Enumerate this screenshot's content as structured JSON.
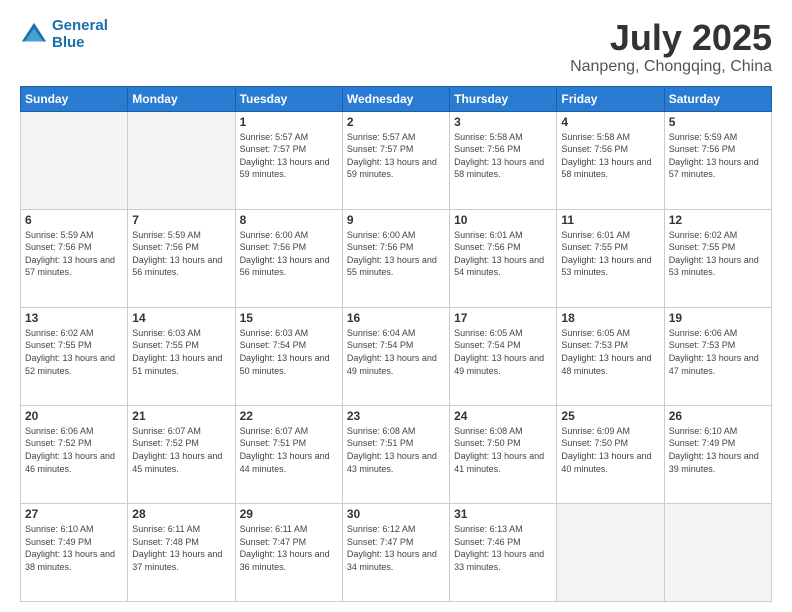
{
  "header": {
    "logo_line1": "General",
    "logo_line2": "Blue",
    "month": "July 2025",
    "location": "Nanpeng, Chongqing, China"
  },
  "weekdays": [
    "Sunday",
    "Monday",
    "Tuesday",
    "Wednesday",
    "Thursday",
    "Friday",
    "Saturday"
  ],
  "weeks": [
    [
      {
        "day": "",
        "empty": true
      },
      {
        "day": "",
        "empty": true
      },
      {
        "day": "1",
        "sunrise": "5:57 AM",
        "sunset": "7:57 PM",
        "daylight": "13 hours and 59 minutes."
      },
      {
        "day": "2",
        "sunrise": "5:57 AM",
        "sunset": "7:57 PM",
        "daylight": "13 hours and 59 minutes."
      },
      {
        "day": "3",
        "sunrise": "5:58 AM",
        "sunset": "7:56 PM",
        "daylight": "13 hours and 58 minutes."
      },
      {
        "day": "4",
        "sunrise": "5:58 AM",
        "sunset": "7:56 PM",
        "daylight": "13 hours and 58 minutes."
      },
      {
        "day": "5",
        "sunrise": "5:59 AM",
        "sunset": "7:56 PM",
        "daylight": "13 hours and 57 minutes."
      }
    ],
    [
      {
        "day": "6",
        "sunrise": "5:59 AM",
        "sunset": "7:56 PM",
        "daylight": "13 hours and 57 minutes."
      },
      {
        "day": "7",
        "sunrise": "5:59 AM",
        "sunset": "7:56 PM",
        "daylight": "13 hours and 56 minutes."
      },
      {
        "day": "8",
        "sunrise": "6:00 AM",
        "sunset": "7:56 PM",
        "daylight": "13 hours and 56 minutes."
      },
      {
        "day": "9",
        "sunrise": "6:00 AM",
        "sunset": "7:56 PM",
        "daylight": "13 hours and 55 minutes."
      },
      {
        "day": "10",
        "sunrise": "6:01 AM",
        "sunset": "7:56 PM",
        "daylight": "13 hours and 54 minutes."
      },
      {
        "day": "11",
        "sunrise": "6:01 AM",
        "sunset": "7:55 PM",
        "daylight": "13 hours and 53 minutes."
      },
      {
        "day": "12",
        "sunrise": "6:02 AM",
        "sunset": "7:55 PM",
        "daylight": "13 hours and 53 minutes."
      }
    ],
    [
      {
        "day": "13",
        "sunrise": "6:02 AM",
        "sunset": "7:55 PM",
        "daylight": "13 hours and 52 minutes."
      },
      {
        "day": "14",
        "sunrise": "6:03 AM",
        "sunset": "7:55 PM",
        "daylight": "13 hours and 51 minutes."
      },
      {
        "day": "15",
        "sunrise": "6:03 AM",
        "sunset": "7:54 PM",
        "daylight": "13 hours and 50 minutes."
      },
      {
        "day": "16",
        "sunrise": "6:04 AM",
        "sunset": "7:54 PM",
        "daylight": "13 hours and 49 minutes."
      },
      {
        "day": "17",
        "sunrise": "6:05 AM",
        "sunset": "7:54 PM",
        "daylight": "13 hours and 49 minutes."
      },
      {
        "day": "18",
        "sunrise": "6:05 AM",
        "sunset": "7:53 PM",
        "daylight": "13 hours and 48 minutes."
      },
      {
        "day": "19",
        "sunrise": "6:06 AM",
        "sunset": "7:53 PM",
        "daylight": "13 hours and 47 minutes."
      }
    ],
    [
      {
        "day": "20",
        "sunrise": "6:06 AM",
        "sunset": "7:52 PM",
        "daylight": "13 hours and 46 minutes."
      },
      {
        "day": "21",
        "sunrise": "6:07 AM",
        "sunset": "7:52 PM",
        "daylight": "13 hours and 45 minutes."
      },
      {
        "day": "22",
        "sunrise": "6:07 AM",
        "sunset": "7:51 PM",
        "daylight": "13 hours and 44 minutes."
      },
      {
        "day": "23",
        "sunrise": "6:08 AM",
        "sunset": "7:51 PM",
        "daylight": "13 hours and 43 minutes."
      },
      {
        "day": "24",
        "sunrise": "6:08 AM",
        "sunset": "7:50 PM",
        "daylight": "13 hours and 41 minutes."
      },
      {
        "day": "25",
        "sunrise": "6:09 AM",
        "sunset": "7:50 PM",
        "daylight": "13 hours and 40 minutes."
      },
      {
        "day": "26",
        "sunrise": "6:10 AM",
        "sunset": "7:49 PM",
        "daylight": "13 hours and 39 minutes."
      }
    ],
    [
      {
        "day": "27",
        "sunrise": "6:10 AM",
        "sunset": "7:49 PM",
        "daylight": "13 hours and 38 minutes."
      },
      {
        "day": "28",
        "sunrise": "6:11 AM",
        "sunset": "7:48 PM",
        "daylight": "13 hours and 37 minutes."
      },
      {
        "day": "29",
        "sunrise": "6:11 AM",
        "sunset": "7:47 PM",
        "daylight": "13 hours and 36 minutes."
      },
      {
        "day": "30",
        "sunrise": "6:12 AM",
        "sunset": "7:47 PM",
        "daylight": "13 hours and 34 minutes."
      },
      {
        "day": "31",
        "sunrise": "6:13 AM",
        "sunset": "7:46 PM",
        "daylight": "13 hours and 33 minutes."
      },
      {
        "day": "",
        "empty": true
      },
      {
        "day": "",
        "empty": true
      }
    ]
  ]
}
